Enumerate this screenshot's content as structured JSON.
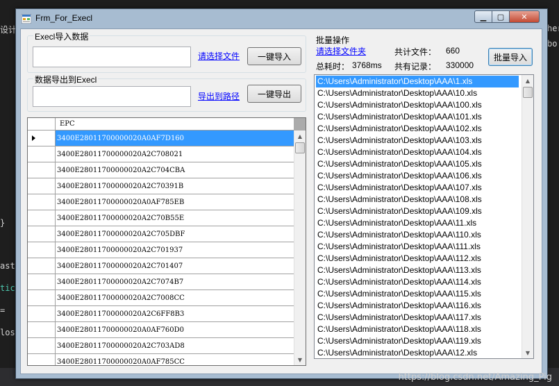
{
  "background": {
    "ide_left_fragments": [
      "设计",
      "}",
      "ast",
      "tic",
      "=",
      "los"
    ],
    "ide_right_fragments": [
      "her",
      "bo"
    ],
    "watermark": "https://blog.csdn.net/Amazing_Pig"
  },
  "window": {
    "title": "Frm_For_Execl",
    "controls": {
      "minimize": "▁",
      "maximize": "▢",
      "close": "✕"
    }
  },
  "import_group": {
    "title": "Execl导入数据",
    "path_value": "",
    "choose_link": "请选择文件",
    "import_button": "一键导入"
  },
  "export_group": {
    "title": "数据导出到Execl",
    "path_value": "",
    "export_link": "导出到路径",
    "export_button": "一键导出"
  },
  "grid": {
    "column": "EPC",
    "rows": [
      "3400E28011700000020A0AF7D160",
      "3400E28011700000020A2C708021",
      "3400E28011700000020A2C704CBA",
      "3400E28011700000020A2C70391B",
      "3400E28011700000020A0AF785EB",
      "3400E28011700000020A2C70B55E",
      "3400E28011700000020A2C705DBF",
      "3400E28011700000020A2C701937",
      "3400E28011700000020A2C701407",
      "3400E28011700000020A2C7074B7",
      "3400E28011700000020A2C7008CC",
      "3400E28011700000020A2C6FF8B3",
      "3400E28011700000020A0AF760D0",
      "3400E28011700000020A2C703AD8",
      "3400E28011700000020A0AF785CC"
    ],
    "selected_index": 0
  },
  "batch": {
    "title": "批量操作",
    "choose_folder_link": "请选择文件夹",
    "total_files_label": "共计文件：",
    "total_files_value": "660",
    "batch_import_button": "批量导入",
    "elapsed_label": "总耗时：",
    "elapsed_value": "3768ms",
    "records_label": "共有记录：",
    "records_value": "330000"
  },
  "file_list": {
    "items": [
      "C:\\Users\\Administrator\\Desktop\\AAA\\1.xls",
      "C:\\Users\\Administrator\\Desktop\\AAA\\10.xls",
      "C:\\Users\\Administrator\\Desktop\\AAA\\100.xls",
      "C:\\Users\\Administrator\\Desktop\\AAA\\101.xls",
      "C:\\Users\\Administrator\\Desktop\\AAA\\102.xls",
      "C:\\Users\\Administrator\\Desktop\\AAA\\103.xls",
      "C:\\Users\\Administrator\\Desktop\\AAA\\104.xls",
      "C:\\Users\\Administrator\\Desktop\\AAA\\105.xls",
      "C:\\Users\\Administrator\\Desktop\\AAA\\106.xls",
      "C:\\Users\\Administrator\\Desktop\\AAA\\107.xls",
      "C:\\Users\\Administrator\\Desktop\\AAA\\108.xls",
      "C:\\Users\\Administrator\\Desktop\\AAA\\109.xls",
      "C:\\Users\\Administrator\\Desktop\\AAA\\11.xls",
      "C:\\Users\\Administrator\\Desktop\\AAA\\110.xls",
      "C:\\Users\\Administrator\\Desktop\\AAA\\111.xls",
      "C:\\Users\\Administrator\\Desktop\\AAA\\112.xls",
      "C:\\Users\\Administrator\\Desktop\\AAA\\113.xls",
      "C:\\Users\\Administrator\\Desktop\\AAA\\114.xls",
      "C:\\Users\\Administrator\\Desktop\\AAA\\115.xls",
      "C:\\Users\\Administrator\\Desktop\\AAA\\116.xls",
      "C:\\Users\\Administrator\\Desktop\\AAA\\117.xls",
      "C:\\Users\\Administrator\\Desktop\\AAA\\118.xls",
      "C:\\Users\\Administrator\\Desktop\\AAA\\119.xls",
      "C:\\Users\\Administrator\\Desktop\\AAA\\12.xls"
    ],
    "selected_index": 0
  },
  "colors": {
    "selection": "#3399ff",
    "link": "#0000ff",
    "window_frame": "#a7bcd1",
    "client_bg": "#f0f0f0"
  }
}
